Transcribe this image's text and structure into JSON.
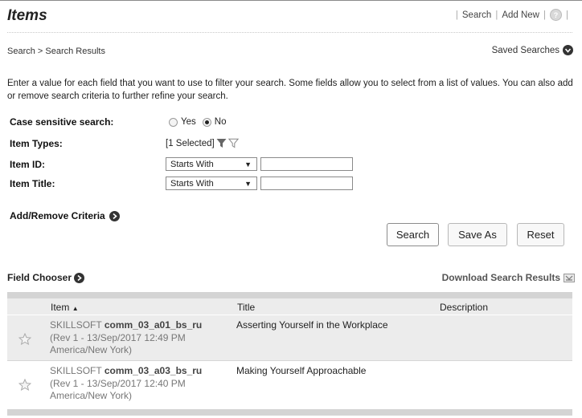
{
  "header": {
    "title": "Items",
    "links": {
      "search": "Search",
      "add_new": "Add New"
    }
  },
  "breadcrumb": "Search > Search Results",
  "saved_searches": "Saved Searches",
  "intro": "Enter a value for each field that you want to use to filter your search. Some fields allow you to select from a list of values. You can also add or remove search criteria to further refine your search.",
  "form": {
    "case_sensitive": {
      "label": "Case sensitive search:",
      "yes": "Yes",
      "no": "No",
      "selected": "No"
    },
    "item_types": {
      "label": "Item Types:",
      "value": "[1 Selected]"
    },
    "item_id": {
      "label": "Item ID:",
      "operator": "Starts With",
      "value": ""
    },
    "item_title": {
      "label": "Item Title:",
      "operator": "Starts With",
      "value": ""
    },
    "add_remove": "Add/Remove Criteria"
  },
  "buttons": {
    "search": "Search",
    "save_as": "Save As",
    "reset": "Reset"
  },
  "results": {
    "field_chooser": "Field Chooser",
    "download": "Download Search Results",
    "columns": {
      "item": "Item",
      "title": "Title",
      "description": "Description"
    },
    "sort_indicator": "▲",
    "rows": [
      {
        "source": "SKILLSOFT",
        "code": "comm_03_a01_bs_ru",
        "rev": "(Rev 1 - 13/Sep/2017 12:49 PM",
        "tz": "America/New York)",
        "title": "Asserting Yourself in the Workplace",
        "description": ""
      },
      {
        "source": "SKILLSOFT",
        "code": "comm_03_a03_bs_ru",
        "rev": "(Rev 1 - 13/Sep/2017 12:40 PM",
        "tz": "America/New York)",
        "title": "Making Yourself Approachable",
        "description": ""
      }
    ]
  },
  "colors": {
    "accent_dark": "#333333",
    "band": "#d4d4d4",
    "row_alt": "#ececec"
  },
  "icons": [
    "help-icon",
    "circle-arrow-down-icon",
    "filter-icon",
    "filter-outline-icon",
    "circle-arrow-right-icon",
    "star-icon",
    "download-icon"
  ]
}
